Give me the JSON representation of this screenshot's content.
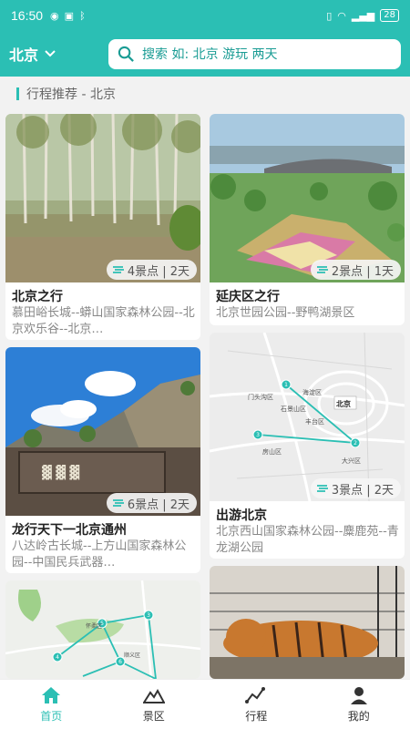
{
  "status": {
    "time": "16:50",
    "battery": "28"
  },
  "header": {
    "city": "北京",
    "search_placeholder": "搜索 如: 北京 游玩 两天"
  },
  "section": {
    "title": "行程推荐 - 北京"
  },
  "cards": [
    {
      "title": "北京之行",
      "desc": "慕田峪长城--蟒山国家森林公园--北京欢乐谷--北京…",
      "badge": "4景点 | 2天"
    },
    {
      "title": "延庆区之行",
      "desc": "北京世园公园--野鸭湖景区",
      "badge": "2景点 | 1天"
    },
    {
      "title": "龙行天下一北京通州",
      "desc": "八达岭古长城--上方山国家森林公园--中国民兵武器…",
      "badge": "6景点 | 2天"
    },
    {
      "title": "出游北京",
      "desc": "北京西山国家森林公园--麋鹿苑--青龙湖公园",
      "badge": "3景点 | 2天"
    }
  ],
  "map_labels": {
    "beijing": "北京",
    "haidian": "海淀区",
    "mentougou": "门头沟区",
    "shijingshan": "石景山区",
    "fengtai": "丰台区",
    "fangshan": "房山区",
    "daxing": "大兴区",
    "huairou": "怀柔区",
    "shunyi": "顺义区"
  },
  "map_markers": [
    "1",
    "2",
    "3",
    "4",
    "5",
    "6"
  ],
  "tabs": [
    {
      "label": "首页",
      "icon": "home-icon",
      "active": true
    },
    {
      "label": "景区",
      "icon": "mountain-icon",
      "active": false
    },
    {
      "label": "行程",
      "icon": "route-icon",
      "active": false
    },
    {
      "label": "我的",
      "icon": "user-icon",
      "active": false
    }
  ],
  "colors": {
    "accent": "#2bbfb4",
    "accent_dark": "#1a9c94"
  }
}
